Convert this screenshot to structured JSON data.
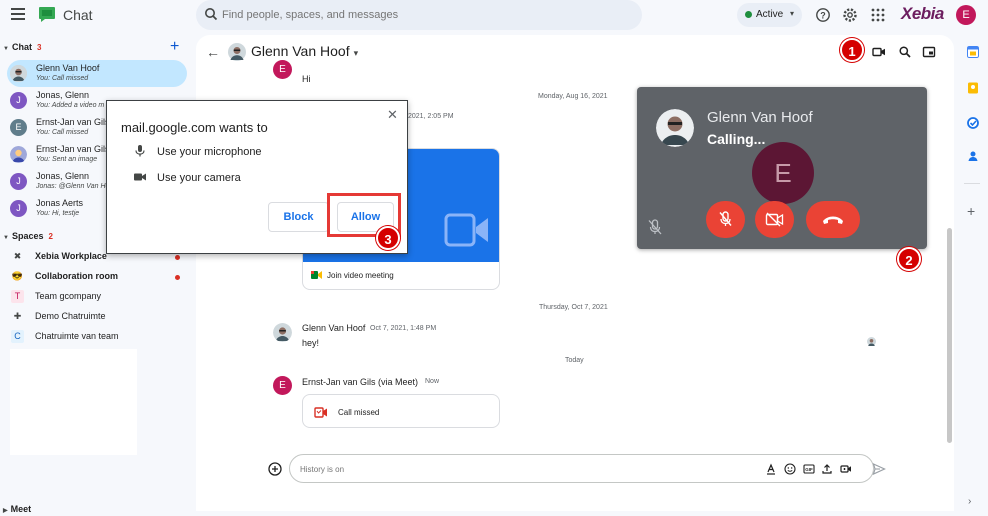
{
  "app": {
    "title": "Chat"
  },
  "search": {
    "placeholder": "Find people, spaces, and messages"
  },
  "status": {
    "label": "Active"
  },
  "brand": {
    "logo_text": "Xebia"
  },
  "user": {
    "initial": "E"
  },
  "sidebar": {
    "chat_section": {
      "label": "Chat",
      "count": "3"
    },
    "dms": [
      {
        "name": "Glenn Van Hoof",
        "preview": "You: Call missed",
        "avatar": "",
        "color": "#8d6e63"
      },
      {
        "name": "Jonas, Glenn",
        "preview": "You: Added a video m",
        "avatar": "J",
        "color": "#7e57c2"
      },
      {
        "name": "Ernst-Jan van Gils",
        "preview": "You: Call missed",
        "avatar": "E",
        "color": "#607d8b"
      },
      {
        "name": "Ernst-Jan van Gils",
        "preview": "You: Sent an image",
        "avatar": "",
        "color": "#5c6bc0"
      },
      {
        "name": "Jonas, Glenn",
        "preview": "Jonas: @Glenn Van Hoof",
        "avatar": "J",
        "color": "#7e57c2"
      },
      {
        "name": "Jonas Aerts",
        "preview": "You: Hi, testje",
        "avatar": "J",
        "color": "#7e57c2"
      }
    ],
    "spaces_section": {
      "label": "Spaces",
      "count": "2"
    },
    "spaces": [
      {
        "name": "Xebia Workplace",
        "icon": "✖",
        "bold": true,
        "unread": true
      },
      {
        "name": "Collaboration room",
        "icon": "😎",
        "bold": true,
        "unread": true
      },
      {
        "name": "Team gcompany",
        "icon": "T",
        "bold": false,
        "unread": false
      },
      {
        "name": "Demo Chatruimte",
        "icon": "✚",
        "bold": false,
        "unread": false
      },
      {
        "name": "Chatruimte van team",
        "icon": "C",
        "bold": false,
        "unread": false
      }
    ],
    "meet_section": {
      "label": "Meet"
    }
  },
  "conversation": {
    "title": "Glenn Van Hoof",
    "messages": {
      "top_text": "Hi",
      "date1": "Monday, Aug 16, 2021",
      "partial_time": "2021, 2:05 PM",
      "join_label": "Join video meeting",
      "date2": "Thursday, Oct 7, 2021",
      "glenn_name": "Glenn Van Hoof",
      "glenn_time": "Oct 7, 2021, 1:48 PM",
      "glenn_text": "hey!",
      "today": "Today",
      "ernst_name": "Ernst-Jan van Gils (via Meet)",
      "ernst_time": "Now",
      "missed_label": "Call missed",
      "ernst_initial": "E"
    },
    "composer_placeholder": "History is on"
  },
  "call": {
    "name": "Glenn Van Hoof",
    "status": "Calling...",
    "self_initial": "E"
  },
  "permission": {
    "site": "mail.google.com",
    "wants": "wants to",
    "mic": "Use your microphone",
    "camera": "Use your camera",
    "block": "Block",
    "allow": "Allow"
  },
  "markers": {
    "one": "1",
    "two": "2",
    "three": "3"
  },
  "colors": {
    "accent": "#0b57d0",
    "danger": "#ea4335",
    "meet_blue": "#1a73e8",
    "brand": "#6c1d5f"
  }
}
